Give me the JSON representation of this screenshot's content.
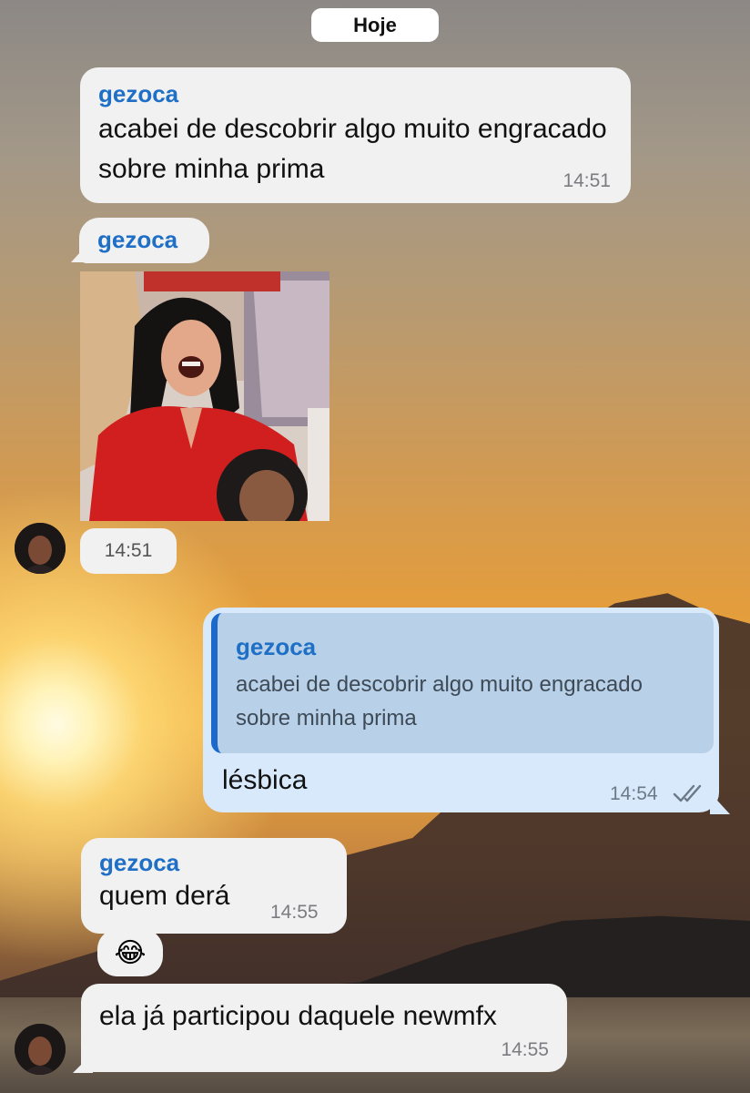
{
  "date_separator": "Hoje",
  "messages": [
    {
      "sender": "gezoca",
      "text": "acabei de descobrir algo muito engracado sobre minha prima",
      "time": "14:51"
    },
    {
      "sender": "gezoca",
      "media": "photo",
      "time": "14:51"
    },
    {
      "outgoing": true,
      "reply_to": {
        "sender": "gezoca",
        "text": "acabei de descobrir algo muito engracado sobre minha prima"
      },
      "text": "lésbica",
      "time": "14:54",
      "status_icon": "double-check-icon"
    },
    {
      "sender": "gezoca",
      "text": "quem derá",
      "time": "14:55"
    },
    {
      "emoji": "😂"
    },
    {
      "text": "ela já participou daquele newmfx",
      "time": "14:55"
    }
  ],
  "colors": {
    "sender_name": "#1e6fc5",
    "incoming_bubble": "#f1f1f2",
    "outgoing_bubble": "#d8e9fb",
    "reply_bar": "#1a69cb"
  }
}
